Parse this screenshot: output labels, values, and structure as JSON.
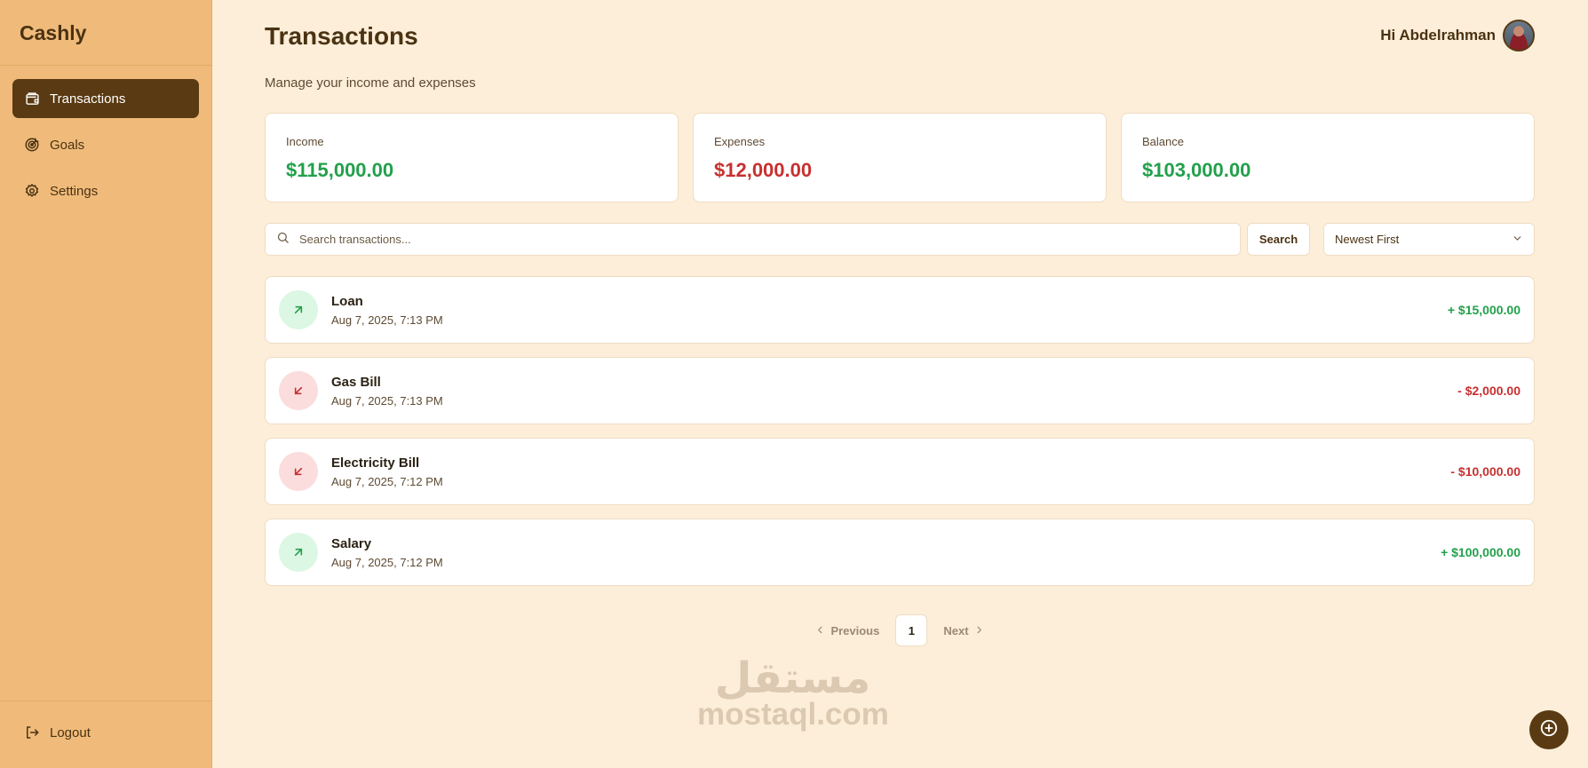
{
  "app": {
    "brand": "Cashly"
  },
  "sidebar": {
    "items": [
      {
        "label": "Transactions",
        "icon": "wallet-icon",
        "active": true
      },
      {
        "label": "Goals",
        "icon": "target-icon",
        "active": false
      },
      {
        "label": "Settings",
        "icon": "gear-icon",
        "active": false
      }
    ],
    "logout": {
      "label": "Logout",
      "icon": "logout-icon"
    }
  },
  "header": {
    "title": "Transactions",
    "subtitle": "Manage your income and expenses",
    "greeting": "Hi Abdelrahman"
  },
  "summary": {
    "income": {
      "label": "Income",
      "value": "$115,000.00"
    },
    "expenses": {
      "label": "Expenses",
      "value": "$12,000.00"
    },
    "balance": {
      "label": "Balance",
      "value": "$103,000.00"
    }
  },
  "toolbar": {
    "search_placeholder": "Search transactions...",
    "search_value": "",
    "search_button": "Search",
    "sort_selected": "Newest First"
  },
  "transactions": [
    {
      "name": "Loan",
      "date": "Aug 7, 2025, 7:13 PM",
      "amount": "+ $15,000.00",
      "type": "income"
    },
    {
      "name": "Gas Bill",
      "date": "Aug 7, 2025, 7:13 PM",
      "amount": "- $2,000.00",
      "type": "expense"
    },
    {
      "name": "Electricity Bill",
      "date": "Aug 7, 2025, 7:12 PM",
      "amount": "- $10,000.00",
      "type": "expense"
    },
    {
      "name": "Salary",
      "date": "Aug 7, 2025, 7:12 PM",
      "amount": "+ $100,000.00",
      "type": "income"
    }
  ],
  "pagination": {
    "previous": "Previous",
    "current": "1",
    "next": "Next"
  },
  "watermark": {
    "arabic": "مستقل",
    "latin": "mostaql.com"
  },
  "colors": {
    "sidebar": "#f0bb7a",
    "background": "#fdeed9",
    "accent": "#5a3a12",
    "income": "#22a04b",
    "expense": "#c7302f"
  }
}
